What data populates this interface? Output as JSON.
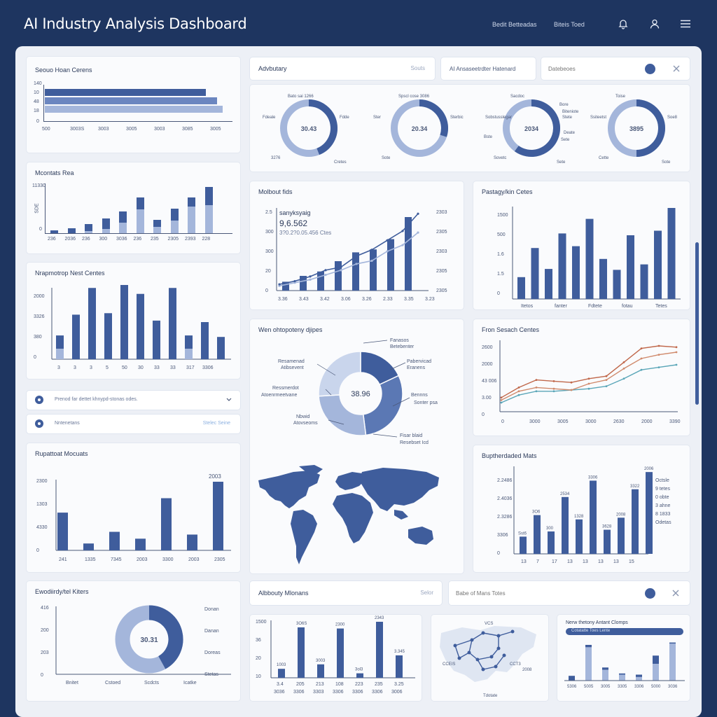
{
  "header": {
    "title": "AI Industry Analysis Dashboard",
    "link1": "Bedit Betteadas",
    "link2": "Biteis Toed",
    "icons": [
      "bell-icon",
      "user-icon",
      "menu-icon"
    ]
  },
  "colors": {
    "dark": "#3f5d9c",
    "light": "#a4b6db",
    "accent": "#c0674a",
    "teal": "#5aa6b8"
  },
  "toolbar1": {
    "dropdown_label": "Advbutary",
    "dropdown_hint": "Souts",
    "filter_label": "AI  Ansaseetrdter  Hatenard",
    "search_placeholder": "Datebeoes"
  },
  "toolbar2": {
    "dropdown_label": "Albbouty Mlonans",
    "dropdown_hint": "Selor",
    "search_placeholder": "Babe of Mans Totes"
  },
  "card_top_left": {
    "title": "Seouo Hoan Cerens",
    "y_ticks": [
      "140",
      "10",
      "48",
      "18",
      "0"
    ],
    "x_ticks": [
      "500",
      "3003S",
      "3003",
      "3005",
      "3003",
      "3085",
      "3005"
    ],
    "values": [
      0.56,
      0.6,
      0.62
    ]
  },
  "donuts": [
    {
      "center": "30.43",
      "ann": [
        "Bato sai 1266",
        "Fdeale",
        "Fdde",
        "3276",
        "Cretes"
      ],
      "pct": 0.44
    },
    {
      "center": "20.34",
      "ann": [
        "Spscl cose 3086",
        "Ster",
        "Sterbic",
        "Sote"
      ],
      "pct": 0.3
    },
    {
      "center": "2034",
      "ann": [
        "Sacdoc",
        "Sobstusslegar",
        "Stete",
        "Sovetc",
        "Sete",
        "Bore",
        "Biteniote",
        "Deate",
        "Sete",
        "Bste"
      ],
      "pct": 0.6
    },
    {
      "center": "3895",
      "ann": [
        "Toise",
        "Ssiteetst",
        "Soe8",
        "Cette",
        "Sote"
      ],
      "pct": 0.5
    }
  ],
  "card_mid_left": {
    "title": "Mcontats Rea",
    "y_ticks": [
      "11330",
      "SDE",
      "0"
    ],
    "x_ticks": [
      "236",
      "2036",
      "236",
      "300",
      "3036",
      "236",
      "235",
      "2305",
      "2393",
      "228"
    ],
    "values": [
      {
        "dark": 6,
        "light": 0
      },
      {
        "dark": 10,
        "light": 0
      },
      {
        "dark": 18,
        "light": 4
      },
      {
        "dark": 28,
        "light": 8
      },
      {
        "dark": 42,
        "light": 20
      },
      {
        "dark": 70,
        "light": 46
      },
      {
        "dark": 26,
        "light": 12
      },
      {
        "dark": 48,
        "light": 24
      },
      {
        "dark": 70,
        "light": 52
      },
      {
        "dark": 90,
        "light": 54
      }
    ]
  },
  "card_line_center": {
    "title": "Molbout fids",
    "headline1": "sanyksyaig",
    "headline2": "9,6.562",
    "headline3": "3?0.2?0.05.456 Ctes",
    "y_ticks_left": [
      "2.5",
      "300",
      "300",
      "20",
      "0"
    ],
    "y_ticks_right": [
      "2303",
      "2305",
      "2303",
      "2305",
      "2305"
    ],
    "x_ticks": [
      "3.36",
      "3.43",
      "3.42",
      "3.06",
      "3.26",
      "2.33",
      "3.35",
      "3.23"
    ],
    "bars": [
      12,
      20,
      26,
      40,
      52,
      56,
      70,
      100
    ],
    "line1": [
      8,
      12,
      18,
      26,
      30,
      44,
      52,
      64,
      76,
      98
    ],
    "line2": [
      6,
      10,
      14,
      20,
      26,
      34,
      38,
      50,
      58,
      74
    ]
  },
  "card_bar_right": {
    "title": "Pastagy/kin Cetes",
    "y_ticks": [
      "1500",
      "500",
      "1.6",
      "1.5",
      "0"
    ],
    "x_ticks": [
      "Itetos",
      "fanter",
      "Fdtete",
      "fotau",
      "Tetes"
    ],
    "values": [
      24,
      56,
      33,
      72,
      58,
      88,
      44,
      32,
      70,
      38,
      75,
      100
    ]
  },
  "card_bar_left2": {
    "title": "Nrapmotrop Nest Centes",
    "y_ticks": [
      "2000",
      "3326",
      "380",
      "0"
    ],
    "x_ticks": [
      "3",
      "3",
      "3",
      "5",
      "50",
      "30",
      "33",
      "33",
      "317",
      "3306"
    ],
    "values": [
      {
        "dark": 32,
        "light": 14
      },
      {
        "dark": 60,
        "light": 0
      },
      {
        "dark": 96,
        "light": 0
      },
      {
        "dark": 62,
        "light": 0
      },
      {
        "dark": 100,
        "light": 0
      },
      {
        "dark": 88,
        "light": 0
      },
      {
        "dark": 52,
        "light": 0
      },
      {
        "dark": 96,
        "light": 0
      },
      {
        "dark": 32,
        "light": 14
      },
      {
        "dark": 50,
        "light": 0
      },
      {
        "dark": 30,
        "light": 0
      }
    ]
  },
  "card_pie": {
    "title": "Wen ohtopoteny djipes",
    "center": "38.96",
    "labels": [
      "Fanasos",
      "Betebenter",
      "Pabervicad",
      "Eranens",
      "Resamenad",
      "Atibsevent",
      "Ressmerdot",
      "Atoenrmeetvane",
      "Bennns",
      "Sonter psa",
      "Nbwid",
      "Atovseoms",
      "Fisar blaid",
      "Resebset Icd"
    ]
  },
  "card_lines_right": {
    "title": "Fron Sesach Centes",
    "y_ticks": [
      "2600",
      "2000",
      "43 006",
      "3.00",
      "0"
    ],
    "x_ticks": [
      "0",
      "3000",
      "3005",
      "3000",
      "2630",
      "2000",
      "3390"
    ],
    "line1": [
      18,
      34,
      46,
      44,
      42,
      48,
      52,
      74,
      96,
      100,
      98
    ],
    "line2": [
      14,
      28,
      34,
      32,
      30,
      40,
      46,
      64,
      80,
      86,
      90
    ],
    "line3": [
      10,
      22,
      28,
      28,
      30,
      32,
      36,
      48,
      62,
      66,
      70
    ]
  },
  "filters": [
    {
      "text": "Prenod far dettet khnypd-stonas odes."
    },
    {
      "text": "Nntenetans",
      "hint": "Stelec  Seine"
    }
  ],
  "card_bar_left3": {
    "title": "Rupattoat Mocuats",
    "y_ticks": [
      "2300",
      "1303",
      "4330",
      "0"
    ],
    "x_ticks": [
      "241",
      "1335",
      "7345",
      "2003",
      "3300",
      "2003",
      "2305"
    ],
    "annotation": "2003",
    "values": [
      55,
      10,
      27,
      17,
      76,
      23,
      100
    ]
  },
  "map": {
    "title": "World Map"
  },
  "card_bar_right3": {
    "title": "Buptherdaded Mats",
    "y_ticks": [
      "2.2486",
      "2.4036",
      "2.3286",
      "3306",
      "0"
    ],
    "x_ticks": [
      "13",
      "7",
      "17",
      "13",
      "13",
      "13",
      "13",
      "15"
    ],
    "values": [
      20,
      45,
      26,
      66,
      40,
      85,
      28,
      42,
      75,
      95
    ],
    "labels": [
      "Sst6",
      "3O6",
      "300",
      "2534",
      "1328",
      "3306",
      "3628",
      "2008",
      "3322",
      "2006"
    ],
    "legend": [
      "Octsle",
      "9 tetes",
      "0 obte",
      "3  ahne",
      "8  1833",
      "Odetas"
    ]
  },
  "card_donut_bottom": {
    "title": "Ewodiirdy/tel Kiters",
    "center": "30.31",
    "pct": 0.42,
    "y_ticks": [
      "416",
      "200",
      "203",
      "0"
    ],
    "x_ticks": [
      "Bnitet",
      "Cstoed",
      "Scdcts",
      "Icatke"
    ],
    "legend": [
      "Donan",
      "Danan",
      "Doreas",
      "Stetas"
    ]
  },
  "card_bar_bottom": {
    "y_ticks": [
      "1500",
      "36",
      "20",
      "10"
    ],
    "x_ticks": [
      "3.4",
      "205",
      "213",
      "108",
      "223",
      "235",
      "3.25"
    ],
    "x_ticks2": [
      "3036",
      "3306",
      "3303",
      "3306",
      "3306",
      "3306",
      "3006"
    ],
    "values": [
      16,
      90,
      24,
      88,
      8,
      100,
      40
    ],
    "labels": [
      "1003",
      "3O6S",
      "3003",
      "2300",
      "3ol3",
      "2343",
      "3.345"
    ]
  },
  "card_network": {
    "labels": [
      "VCS",
      "CCEIS",
      "CCT3",
      "2008",
      "Tdotate"
    ]
  },
  "card_small_bars": {
    "title": "Nerw thetony Antant Clomps",
    "sub": "Cotatatte Toes Lente",
    "values": [
      {
        "dark": 8,
        "light": 0
      },
      {
        "dark": 60,
        "light": 56
      },
      {
        "dark": 22,
        "light": 18
      },
      {
        "dark": 12,
        "light": 10
      },
      {
        "dark": 10,
        "light": 6
      },
      {
        "dark": 42,
        "light": 28
      },
      {
        "dark": 64,
        "light": 62
      }
    ],
    "x_ticks": [
      "5306",
      "5005",
      "3005",
      "3305",
      "3306",
      "5000",
      "3036"
    ]
  }
}
